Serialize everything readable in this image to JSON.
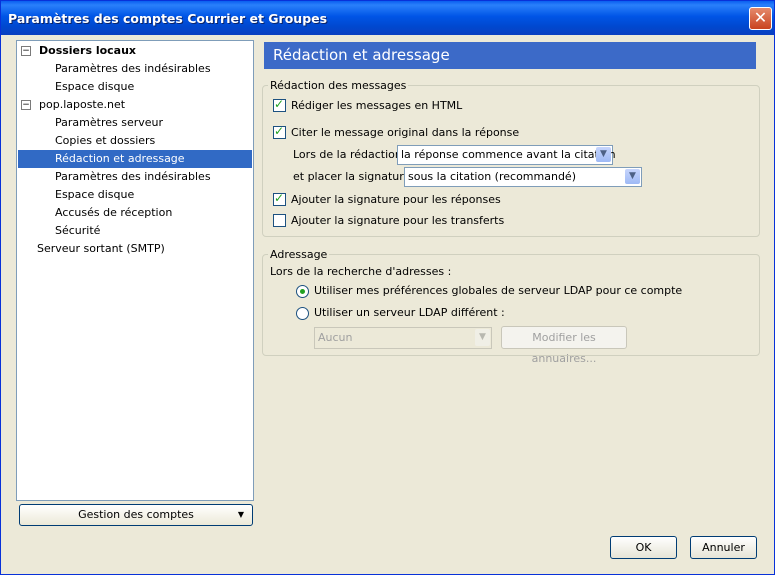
{
  "window": {
    "title": "Paramètres des comptes Courrier et Groupes",
    "close_glyph": "✕"
  },
  "tree": {
    "items": [
      {
        "label": "Dossiers locaux",
        "toggle": "−",
        "bold": true
      },
      {
        "label": "Paramètres des indésirables"
      },
      {
        "label": "Espace disque"
      },
      {
        "label": "pop.laposte.net",
        "toggle": "−"
      },
      {
        "label": "Paramètres serveur"
      },
      {
        "label": "Copies et dossiers"
      },
      {
        "label": "Rédaction et adressage",
        "selected": true
      },
      {
        "label": "Paramètres des indésirables"
      },
      {
        "label": "Espace disque"
      },
      {
        "label": "Accusés de réception"
      },
      {
        "label": "Sécurité"
      },
      {
        "label": "Serveur sortant (SMTP)"
      }
    ]
  },
  "account_button": {
    "label": "Gestion des comptes",
    "arrow": "▼"
  },
  "panel": {
    "header": "Rédaction et adressage",
    "composition": {
      "legend": "Rédaction des messages",
      "html_checkbox": {
        "label": "Rédiger les messages en HTML",
        "checked": true
      },
      "quote_checkbox": {
        "label": "Citer le message original dans la réponse",
        "checked": true
      },
      "reply_label": "Lors de la rédaction",
      "reply_select": "la réponse commence avant la citation",
      "signature_label": "et placer la signature",
      "signature_select": "sous la citation (recommandé)",
      "sig_replies_checkbox": {
        "label": "Ajouter la signature pour les réponses",
        "checked": true
      },
      "sig_forwards_checkbox": {
        "label": "Ajouter la signature pour les transferts",
        "checked": false
      }
    },
    "addressing": {
      "legend": "Adressage",
      "search_label": "Lors de la recherche d'adresses :",
      "global_ldap_radio": {
        "label": "Utiliser mes préférences globales de serveur LDAP pour ce compte",
        "checked": true
      },
      "custom_ldap_radio": {
        "label": "Utiliser un serveur LDAP différent :",
        "checked": false
      },
      "ldap_select": "Aucun",
      "edit_directories_button": "Modifier les annuaires..."
    }
  },
  "footer": {
    "ok_label": "OK",
    "cancel_label": "Annuler"
  },
  "dropdown_glyph": "▼"
}
